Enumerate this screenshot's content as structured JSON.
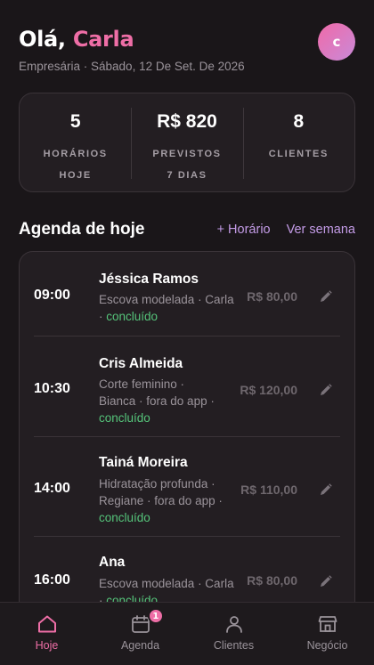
{
  "header": {
    "greeting": "Olá,",
    "user_name": "Carla",
    "subtitle": "Empresária · Sábado, 12 De Set. De 2026",
    "avatar_initial": "c"
  },
  "stats": [
    {
      "value": "5",
      "label_line1": "HORÁRIOS",
      "label_line2": "HOJE"
    },
    {
      "value": "R$ 820",
      "label_line1": "PREVISTOS",
      "label_line2": "7 DIAS"
    },
    {
      "value": "8",
      "label_line1": "CLIENTES",
      "label_line2": ""
    }
  ],
  "agenda": {
    "title": "Agenda de hoje",
    "add_label": "+ Horário",
    "week_label": "Ver semana",
    "items": [
      {
        "time": "09:00",
        "client": "Jéssica Ramos",
        "desc_line1": "Escova modelada · Carla",
        "desc_line2": "· ",
        "status": "concluído",
        "price": "R$ 80,00"
      },
      {
        "time": "10:30",
        "client": "Cris Almeida",
        "desc_line1": "Corte feminino ·",
        "desc_line2": "Bianca · fora do app ·",
        "status": "concluído",
        "price": "R$ 120,00"
      },
      {
        "time": "14:00",
        "client": "Tainá Moreira",
        "desc_line1": "Hidratação profunda ·",
        "desc_line2": "Regiane · fora do app ·",
        "status": "concluído",
        "price": "R$ 110,00"
      },
      {
        "time": "16:00",
        "client": "Ana",
        "desc_line1": "Escova modelada · Carla",
        "desc_line2": "· ",
        "status": "concluído",
        "price": "R$ 80,00"
      }
    ]
  },
  "tabbar": {
    "items": [
      {
        "label": "Hoje",
        "icon": "home-icon",
        "active": true
      },
      {
        "label": "Agenda",
        "icon": "calendar-icon",
        "badge": "1"
      },
      {
        "label": "Clientes",
        "icon": "user-icon"
      },
      {
        "label": "Negócio",
        "icon": "store-icon"
      }
    ]
  },
  "colors": {
    "accent": "#ee6ea6",
    "link": "#c39be6",
    "success": "#55c47a",
    "background": "#1a1619"
  }
}
